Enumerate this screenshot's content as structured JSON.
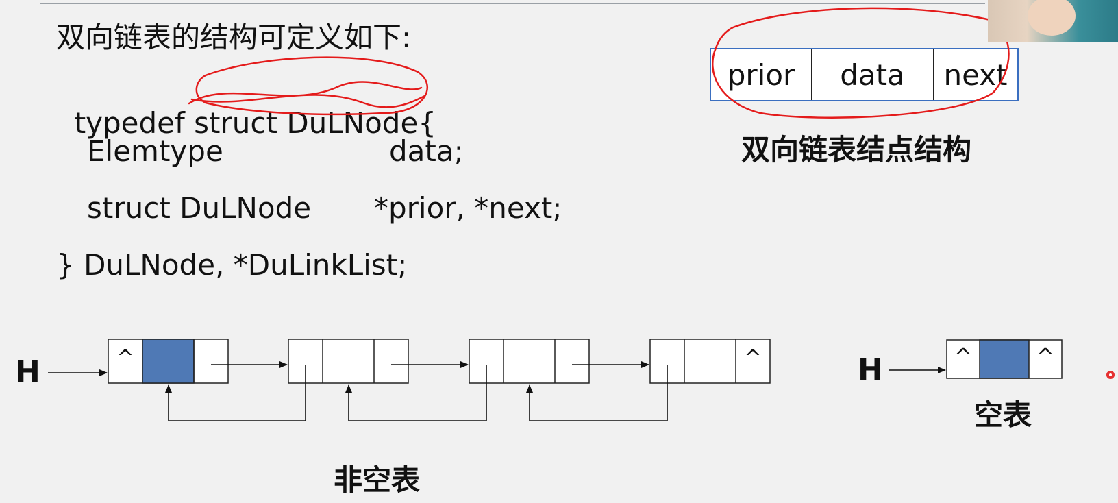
{
  "code": {
    "line1": "双向链表的结构可定义如下:",
    "line2_kw": "typedef ",
    "line2_struck": "struct DuLNode",
    "line2_brace": "{",
    "line3_type": "Elemtype",
    "line3_field": "data;",
    "line4_type": "struct DuLNode",
    "line4_field": "*prior, *next;",
    "line5": "} DuLNode, *DuLinkList;"
  },
  "node_structure": {
    "cells": [
      "prior",
      "data",
      "next"
    ],
    "caption": "双向链表结点结构"
  },
  "nonempty_list": {
    "head_label": "H",
    "null_symbol": "^",
    "caption": "非空表",
    "node_count": 4
  },
  "empty_list": {
    "head_label": "H",
    "null_symbol": "^",
    "caption": "空表"
  },
  "colors": {
    "head_data_fill": "#4f79b5",
    "annotation_red": "#e41b1b",
    "table_border": "#3b6fc0"
  }
}
